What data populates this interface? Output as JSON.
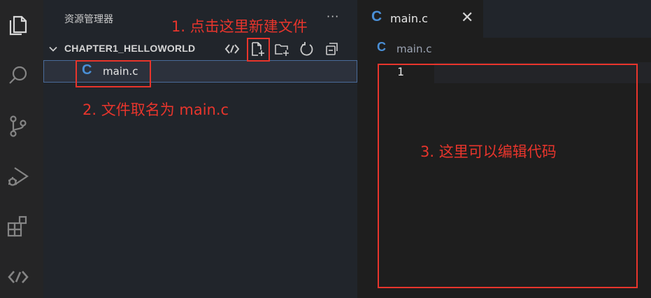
{
  "explorer": {
    "title": "资源管理器",
    "more_label": "···",
    "section_title": "CHAPTER1_HELLOWORLD",
    "file": {
      "icon_letter": "C",
      "name": "main.c"
    }
  },
  "editor": {
    "tab": {
      "icon_letter": "C",
      "label": "main.c",
      "close_label": "✕"
    },
    "breadcrumb": {
      "icon_letter": "C",
      "label": "main.c"
    },
    "line_number": "1"
  },
  "annotations": {
    "step1": "1. 点击这里新建文件",
    "step2": "2. 文件取名为 main.c",
    "step3": "3. 这里可以编辑代码"
  },
  "colors": {
    "annotation_red": "#e8352c",
    "c_icon_blue": "#4a8fd6",
    "selection_border": "#4a6b9a"
  }
}
